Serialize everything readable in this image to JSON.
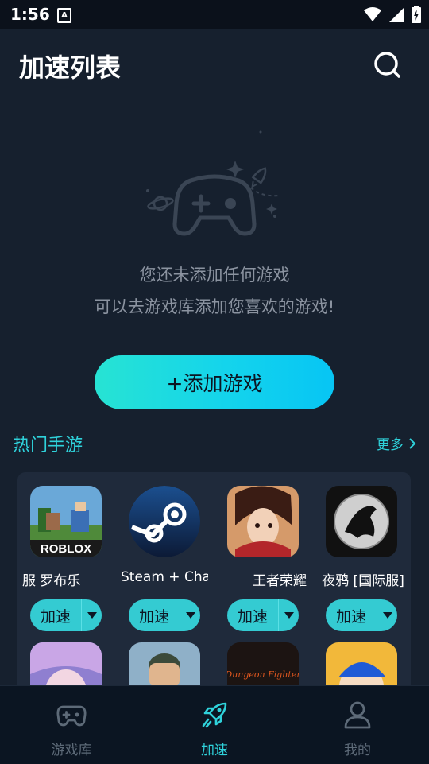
{
  "status_bar": {
    "time": "1:56",
    "notification_badge": "A"
  },
  "header": {
    "title": "加速列表",
    "search_icon": "search-icon"
  },
  "empty_state": {
    "line1": "您还未添加任何游戏",
    "line2": "可以去游戏库添加您喜欢的游戏!"
  },
  "add_button": {
    "label": "+添加游戏"
  },
  "hot_section": {
    "title": "热门手游",
    "more_label": "更多"
  },
  "games": [
    {
      "name": "罗布乐思国际服",
      "name_visible": "服    罗布乐",
      "speed_label": "加速",
      "icon_text": "ROBLOX"
    },
    {
      "name": "Steam + Chat",
      "name_visible": "Steam + Chat",
      "speed_label": "加速",
      "icon_text": ""
    },
    {
      "name": "王者荣耀",
      "name_visible": "王者荣耀",
      "speed_label": "加速",
      "icon_text": ""
    },
    {
      "name": "夜鸦 [国际服]",
      "name_visible": "夜鸦 [国际服]",
      "speed_label": "加速",
      "icon_text": ""
    }
  ],
  "second_row_icons": [
    {
      "icon_text": ""
    },
    {
      "icon_text": ""
    },
    {
      "icon_text": "Dungeon Fighter"
    },
    {
      "icon_text": ""
    }
  ],
  "tabs": [
    {
      "label": "游戏库",
      "icon": "gamepad-icon",
      "active": false
    },
    {
      "label": "加速",
      "icon": "rocket-icon",
      "active": true
    },
    {
      "label": "我的",
      "icon": "user-icon",
      "active": false
    }
  ],
  "colors": {
    "accent": "#2fd2db",
    "background": "#16202e",
    "card": "#1f2a3b",
    "tab_inactive": "#5d6a78"
  }
}
